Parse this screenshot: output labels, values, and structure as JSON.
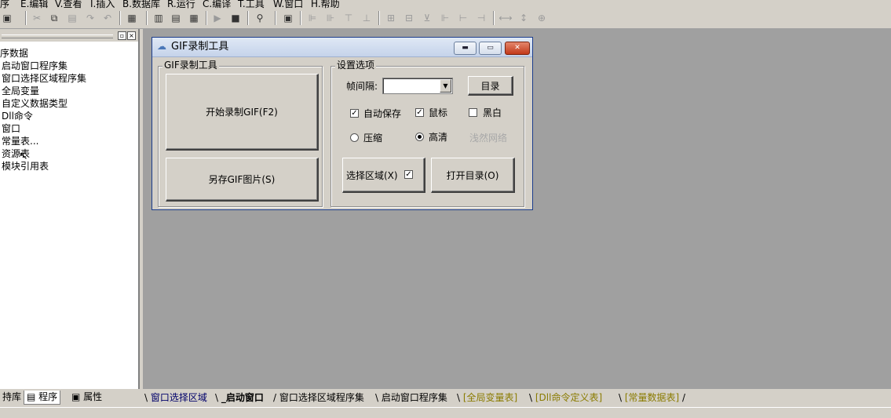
{
  "menu": [
    "序",
    "E.编辑",
    "V.查看",
    "I.插入",
    "B.数据库",
    "R.运行",
    "C.编译",
    "T.工具",
    "W.窗口",
    "H.帮助"
  ],
  "toolbar_icons": [
    "save-icon",
    "cut-icon",
    "copy-icon",
    "paste-icon",
    "redo-icon",
    "undo-icon",
    "find-icon",
    "layout-1-icon",
    "layout-2-icon",
    "layout-3-icon",
    "run-icon",
    "stop-icon",
    "binoculars-icon",
    "form-icon",
    "align-left-icon",
    "align-right-icon",
    "align-top-icon",
    "align-bottom-icon",
    "center-h-icon",
    "center-v-icon",
    "space-h-icon",
    "space-v-icon",
    "same-width-icon",
    "same-height-icon",
    "same-size-icon"
  ],
  "tree": {
    "items": [
      "序数据",
      "启动窗口程序集",
      "窗口选择区域程序集",
      "全局变量",
      "自定义数据类型",
      "Dll命令",
      "窗口",
      "常量表...",
      "资源表",
      "模块引用表"
    ]
  },
  "left_tabs": [
    "持库",
    "程序",
    "属性"
  ],
  "doc_tabs": [
    {
      "label": "窗口选择区域",
      "style": "blue"
    },
    {
      "label": "_启动窗口",
      "style": "active"
    },
    {
      "label": "窗口选择区域程序集",
      "style": "plain"
    },
    {
      "label": "启动窗口程序集",
      "style": "plain"
    },
    {
      "label": "[全局变量表]",
      "style": "yellow"
    },
    {
      "label": "[Dll命令定义表]",
      "style": "yellow"
    },
    {
      "label": "[常量数据表]",
      "style": "yellow"
    }
  ],
  "dialog": {
    "title": "GIF录制工具",
    "group_left": "GIF录制工具",
    "start_button": "开始录制GIF(F2)",
    "save_button": "另存GIF图片(S)",
    "group_right": "设置选项",
    "interval_label": "帧间隔:",
    "interval_value": "",
    "dir_button": "目录",
    "auto_save": {
      "label": "自动保存",
      "checked": true
    },
    "mouse": {
      "label": "鼠标",
      "checked": true
    },
    "black_white": {
      "label": "黑白",
      "checked": false
    },
    "compress": {
      "label": "压缩",
      "selected": false
    },
    "hd": {
      "label": "高清",
      "selected": true
    },
    "watermark": "浅然网络",
    "select_area_button": "选择区域(X)",
    "select_area_checked": true,
    "open_dir_button": "打开目录(O)"
  }
}
